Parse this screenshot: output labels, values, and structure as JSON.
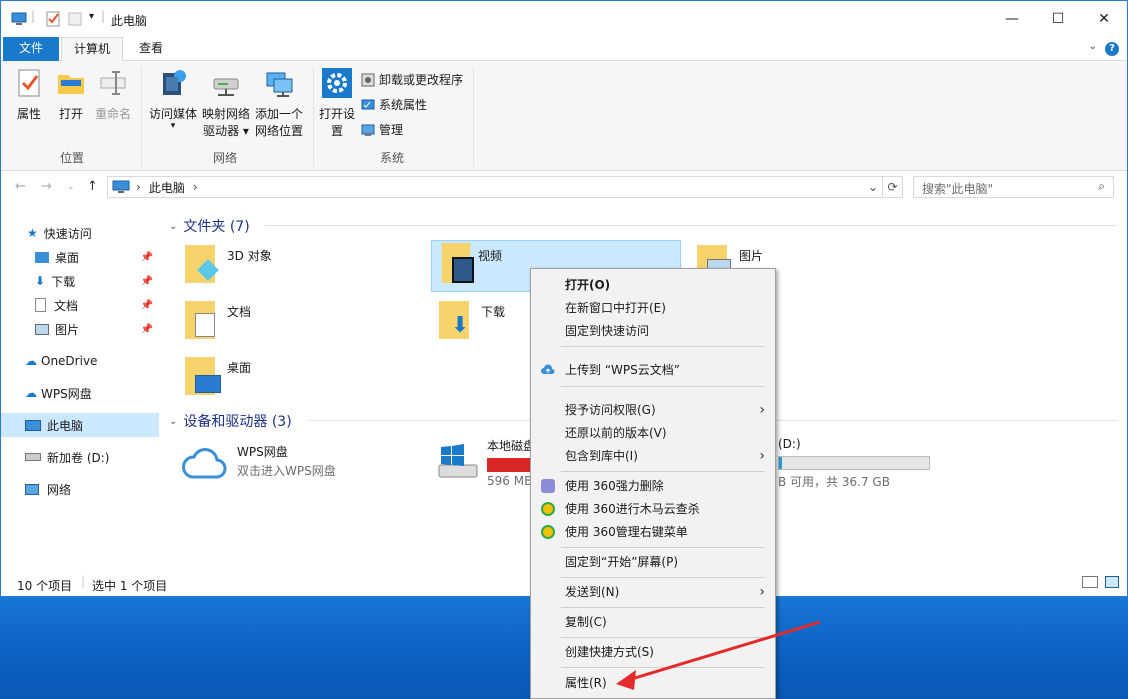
{
  "window": {
    "title": "此电脑"
  },
  "tabs": [
    {
      "label": "文件"
    },
    {
      "label": "计算机"
    },
    {
      "label": "查看"
    }
  ],
  "ribbon": {
    "location_group": {
      "label": "位置",
      "buttons": [
        {
          "label": "属性"
        },
        {
          "label": "打开"
        },
        {
          "label": "重命名"
        }
      ]
    },
    "network_group": {
      "label": "网络",
      "buttons": [
        {
          "label": "访问媒体"
        },
        {
          "label": "映射网络驱动器"
        },
        {
          "label": "添加一个网络位置"
        }
      ]
    },
    "system_group": {
      "label": "系统",
      "open_settings": "打开设置",
      "items": [
        {
          "label": "卸载或更改程序"
        },
        {
          "label": "系统属性"
        },
        {
          "label": "管理"
        }
      ]
    }
  },
  "address": {
    "path": "此电脑",
    "search_placeholder": "搜索\"此电脑\""
  },
  "sidebar": {
    "items": [
      {
        "label": "快速访问"
      },
      {
        "label": "桌面"
      },
      {
        "label": "下载"
      },
      {
        "label": "文档"
      },
      {
        "label": "图片"
      },
      {
        "label": "OneDrive"
      },
      {
        "label": "WPS网盘"
      },
      {
        "label": "此电脑"
      },
      {
        "label": "新加卷 (D:)"
      },
      {
        "label": "网络"
      }
    ]
  },
  "content": {
    "folders_header": "文件夹 (7)",
    "folders": [
      {
        "label": "3D 对象"
      },
      {
        "label": "视频"
      },
      {
        "label": "图片"
      },
      {
        "label": "文档"
      },
      {
        "label": "下载"
      },
      {
        "label": "桌面"
      }
    ],
    "drives_header": "设备和驱动器 (3)",
    "drives": [
      {
        "label": "WPS网盘",
        "sub": "双击进入WPS网盘"
      },
      {
        "label": "本地磁盘",
        "sub": "596 MB",
        "fill": 0.98
      },
      {
        "label": "(D:)",
        "sub": "B 可用，共 36.7 GB",
        "fill": 0.02
      }
    ]
  },
  "status": {
    "count": "10 个项目",
    "selected": "选中 1 个项目"
  },
  "context_menu": {
    "items": [
      "打开(O)",
      "在新窗口中打开(E)",
      "固定到快速访问",
      "上传到 “WPS云文档”",
      "授予访问权限(G)",
      "还原以前的版本(V)",
      "包含到库中(I)",
      "使用 360强力删除",
      "使用 360进行木马云查杀",
      "使用 360管理右键菜单",
      "固定到“开始”屏幕(P)",
      "发送到(N)",
      "复制(C)",
      "创建快捷方式(S)",
      "属性(R)"
    ]
  },
  "colors": {
    "accent": "#1979ca",
    "selection": "#cce8ff",
    "annotation_arrow": "#e52a2a"
  }
}
